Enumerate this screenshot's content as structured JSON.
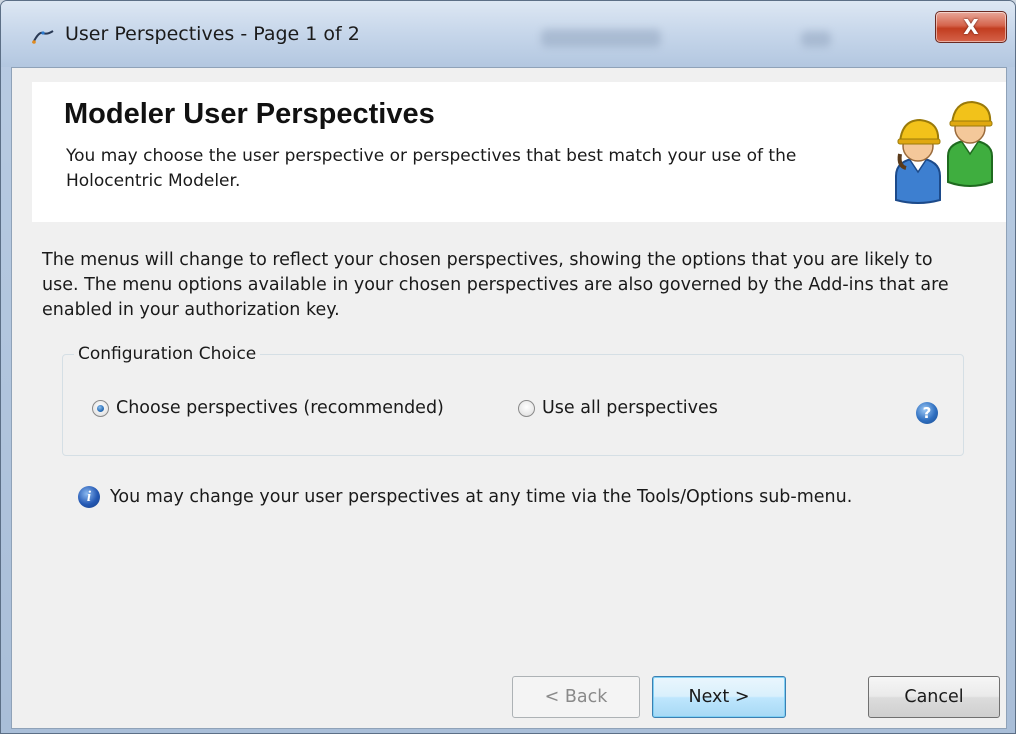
{
  "window": {
    "title": "User Perspectives - Page 1 of 2",
    "close_label": "X"
  },
  "header": {
    "title": "Modeler User Perspectives",
    "description": "You may choose the user perspective or perspectives that best match your use of the Holocentric Modeler."
  },
  "body": {
    "intro": "The menus will change to reflect your chosen perspectives, showing the options that you are likely to use. The menu options available in your chosen perspectives are also governed by the Add-ins that are enabled in your authorization key."
  },
  "configuration": {
    "legend": "Configuration Choice",
    "options": [
      {
        "label": "Choose perspectives (recommended)",
        "checked": true
      },
      {
        "label": "Use all perspectives",
        "checked": false
      }
    ],
    "help_icon": "?"
  },
  "info": {
    "icon": "i",
    "text": "You may change your user perspectives at any time via the Tools/Options sub-menu."
  },
  "buttons": {
    "back": "< Back",
    "next": "Next >",
    "cancel": "Cancel"
  },
  "colors": {
    "accent": "#2f6fc0",
    "close_red": "#c23d20",
    "default_button": "#3c7fb1"
  }
}
